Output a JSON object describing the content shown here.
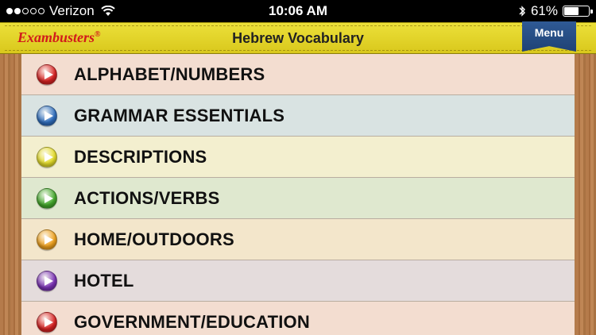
{
  "status_bar": {
    "carrier": "Verizon",
    "signal_bars_filled": 2,
    "signal_bars_total": 5,
    "time": "10:06 AM",
    "battery_percent": "61%",
    "battery_level": 0.61
  },
  "header": {
    "brand": "Exambusters",
    "brand_mark": "®",
    "title": "Hebrew Vocabulary",
    "menu_label": "Menu"
  },
  "items": [
    {
      "label": "ALPHABET/NUMBERS",
      "bg": "#f3ddd0",
      "icon_color": "#d92323"
    },
    {
      "label": "GRAMMAR ESSENTIALS",
      "bg": "#d9e3e2",
      "icon_color": "#2f6fc0"
    },
    {
      "label": "DESCRIPTIONS",
      "bg": "#f3efcf",
      "icon_color": "#e6de2a"
    },
    {
      "label": "ACTIONS/VERBS",
      "bg": "#dfe8cf",
      "icon_color": "#44aa2c"
    },
    {
      "label": "HOME/OUTDOORS",
      "bg": "#f3e6cb",
      "icon_color": "#f0a21e"
    },
    {
      "label": "HOTEL",
      "bg": "#e4dcdc",
      "icon_color": "#7b32b6"
    },
    {
      "label": "GOVERNMENT/EDUCATION",
      "bg": "#f3ddd0",
      "icon_color": "#d92323"
    }
  ]
}
